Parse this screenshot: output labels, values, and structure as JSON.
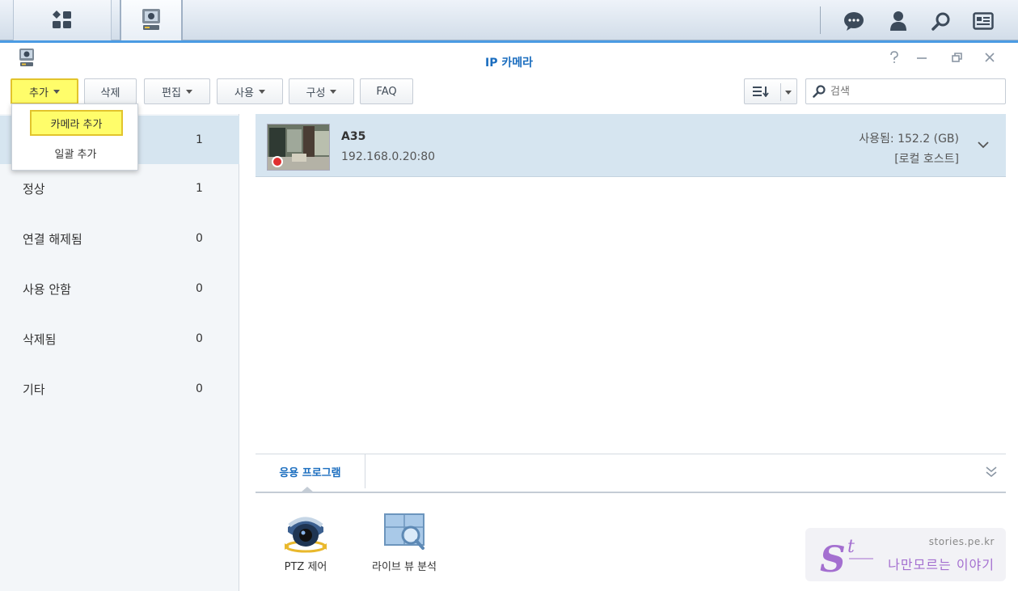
{
  "taskbar": {
    "main_menu_icon": "grid-menu-icon",
    "app_icon": "ip-camera-app-icon",
    "right_icons": [
      "chat-icon",
      "user-icon",
      "search-icon",
      "widgets-icon"
    ]
  },
  "window": {
    "title": "IP 카메라",
    "controls": [
      "help-icon",
      "minimize-icon",
      "restore-icon",
      "close-icon"
    ]
  },
  "toolbar": {
    "add_label": "추가",
    "delete_label": "삭제",
    "edit_label": "편집",
    "use_label": "사용",
    "config_label": "구성",
    "faq_label": "FAQ",
    "search_placeholder": "검색"
  },
  "dropdown": {
    "items": [
      "카메라 추가",
      "일괄 추가"
    ]
  },
  "sidebar": {
    "items": [
      {
        "label": "",
        "count": "1"
      },
      {
        "label": "정상",
        "count": "1"
      },
      {
        "label": "연결 해제됨",
        "count": "0"
      },
      {
        "label": "사용 안함",
        "count": "0"
      },
      {
        "label": "삭제됨",
        "count": "0"
      },
      {
        "label": "기타",
        "count": "0"
      }
    ]
  },
  "camera": {
    "name": "A35",
    "ip": "192.168.0.20:80",
    "usage": "사용됨: 152.2 (GB)",
    "host": "[로컬 호스트]",
    "recording_color": "#e03030"
  },
  "apps": {
    "tab_label": "응용 프로그램",
    "items": [
      {
        "label": "PTZ 제어",
        "icon": "ptz-camera-icon"
      },
      {
        "label": "라이브 뷰 분석",
        "icon": "live-view-analytics-icon"
      }
    ]
  },
  "watermark": {
    "url": "stories.pe.kr",
    "text": "나만모르는 이야기",
    "logo": "St"
  },
  "colors": {
    "accent": "#4b9be3",
    "title": "#1a6dbf",
    "highlight": "#fffd6a",
    "selected_row": "#d6e5f0"
  }
}
